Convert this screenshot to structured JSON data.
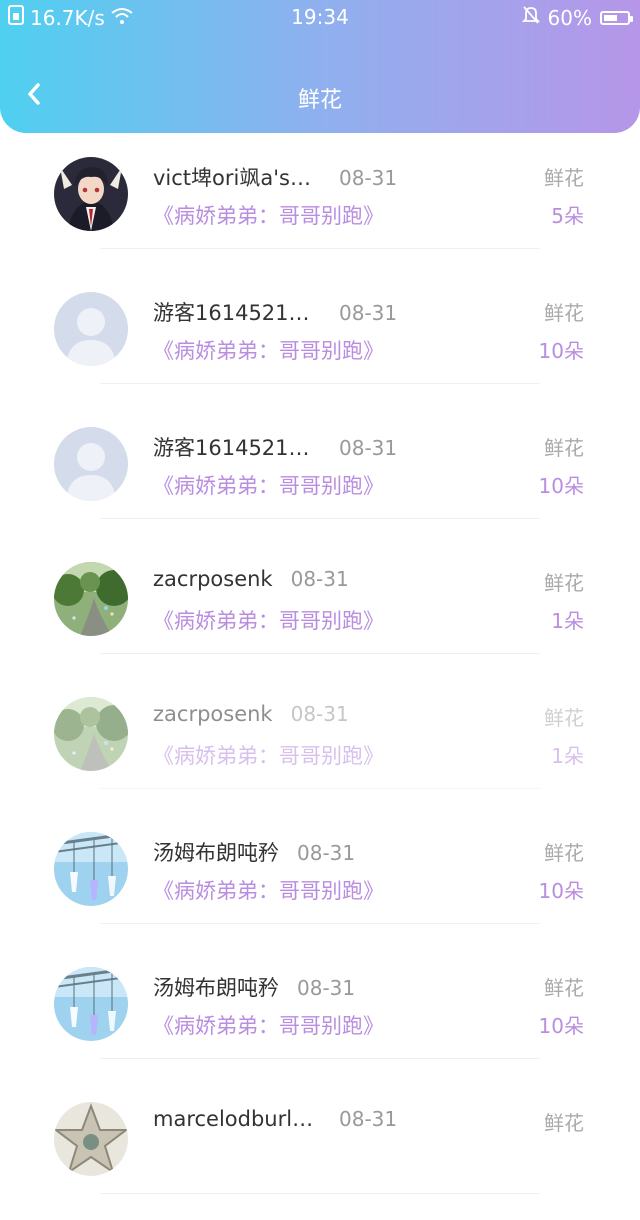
{
  "status_bar": {
    "network_speed": "16.7K/s",
    "time": "19:34",
    "battery_percent": "60%",
    "battery_level": 0.6
  },
  "nav": {
    "title": "鲜花"
  },
  "rows": [
    {
      "name": "vict埤ori飒a'sse...",
      "date": "08-31",
      "book": "《病娇弟弟：哥哥别跑》",
      "gift_type": "鲜花",
      "count": "5朵",
      "avatar": "anime-boy"
    },
    {
      "name": "游客16145212...",
      "date": "08-31",
      "book": "《病娇弟弟：哥哥别跑》",
      "gift_type": "鲜花",
      "count": "10朵",
      "avatar": "default"
    },
    {
      "name": "游客16145212...",
      "date": "08-31",
      "book": "《病娇弟弟：哥哥别跑》",
      "gift_type": "鲜花",
      "count": "10朵",
      "avatar": "default"
    },
    {
      "name": "zacrposenk",
      "date": "08-31",
      "book": "《病娇弟弟：哥哥别跑》",
      "gift_type": "鲜花",
      "count": "1朵",
      "avatar": "forest"
    },
    {
      "name": "zacrposenk",
      "date": "08-31",
      "book": "《病娇弟弟：哥哥别跑》",
      "gift_type": "鲜花",
      "count": "1朵",
      "avatar": "forest"
    },
    {
      "name": "汤姆布朗吨矜",
      "date": "08-31",
      "book": "《病娇弟弟：哥哥别跑》",
      "gift_type": "鲜花",
      "count": "10朵",
      "avatar": "windchime"
    },
    {
      "name": "汤姆布朗吨矜",
      "date": "08-31",
      "book": "《病娇弟弟：哥哥别跑》",
      "gift_type": "鲜花",
      "count": "10朵",
      "avatar": "windchime"
    },
    {
      "name": "marcelodburlbon",
      "date": "08-31",
      "book": "",
      "gift_type": "鲜花",
      "count": "",
      "avatar": "star"
    }
  ]
}
